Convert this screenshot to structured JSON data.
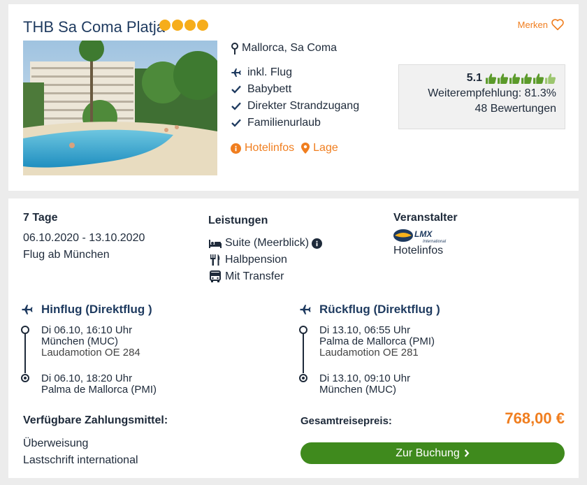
{
  "hotel": {
    "name": "THB Sa Coma Platja",
    "stars": 4,
    "star_color": "#f6ad1b",
    "merken_label": "Merken",
    "location": "Mallorca, Sa Coma",
    "features": [
      "inkl. Flug",
      "Babybett",
      "Direkter Strandzugang",
      "Familienurlaub"
    ],
    "feature_icons": [
      "plane-icon",
      "check-icon",
      "check-icon",
      "check-icon"
    ],
    "link_hotelinfos": "Hotelinfos",
    "link_lage": "Lage",
    "rating": {
      "score": "5.1",
      "thumbs_filled": 5,
      "thumbs_partial": 1,
      "recommendation": "Weiterempfehlung: 81.3%",
      "reviews": "48 Bewertungen"
    }
  },
  "offer": {
    "duration": "7 Tage",
    "dates": "06.10.2020 - 13.10.2020",
    "departure": "Flug ab München",
    "services_heading": "Leistungen",
    "services": [
      "Suite (Meerblick)",
      "Halbpension",
      "Mit Transfer"
    ],
    "operator_heading": "Veranstalter",
    "operator_logo_text": "LMX",
    "operator_logo_sub": "International",
    "operator_link": "Hotelinfos"
  },
  "outbound": {
    "heading": "Hinflug (Direktflug )",
    "dep_time": "Di 06.10, 16:10 Uhr",
    "dep_airport": "München (MUC)",
    "airline": "Laudamotion OE 284",
    "arr_time": "Di 06.10, 18:20 Uhr",
    "arr_airport": "Palma de Mallorca (PMI)"
  },
  "return": {
    "heading": "Rückflug (Direktflug )",
    "dep_time": "Di 13.10, 06:55 Uhr",
    "dep_airport": "Palma de Mallorca (PMI)",
    "airline": "Laudamotion OE 281",
    "arr_time": "Di 13.10, 09:10 Uhr",
    "arr_airport": "München (MUC)"
  },
  "payment": {
    "heading": "Verfügbare Zahlungsmittel:",
    "methods": [
      "Überweisung",
      "Lastschrift international"
    ]
  },
  "total": {
    "label": "Gesamtreisepreis:",
    "price": "768,00 €",
    "button": "Zur Buchung"
  },
  "colors": {
    "accent": "#f07e1f",
    "primary": "#1e3a5f",
    "button_green": "#3f8a1d",
    "thumb_green": "#5b9a2a"
  }
}
